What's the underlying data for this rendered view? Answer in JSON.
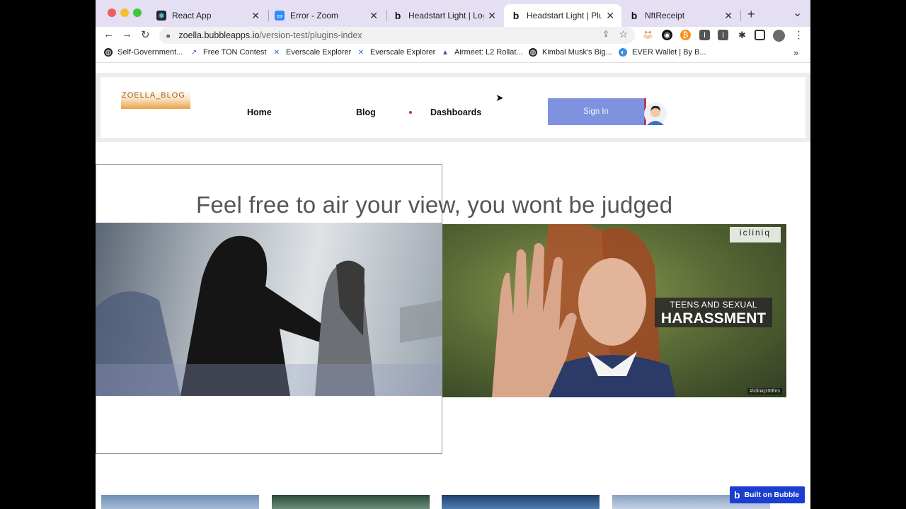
{
  "tabs": [
    {
      "label": "React App",
      "icon": "react-icon",
      "close": "✕"
    },
    {
      "label": "Error - Zoom",
      "icon": "zoom-icon",
      "close": "✕"
    },
    {
      "label": "Headstart Light | Login",
      "icon": "bubble-icon",
      "close": "✕"
    },
    {
      "label": "Headstart Light | Plugins",
      "icon": "bubble-icon",
      "close": "✕",
      "active": true
    },
    {
      "label": "NftReceipt",
      "icon": "bubble-icon",
      "close": "✕"
    }
  ],
  "new_tab": "+",
  "tab_menu": "⌄",
  "toolbar": {
    "back": "←",
    "forward": "→",
    "reload": "↻",
    "url_host": "zoella.bubbleapps.io",
    "url_path": "/version-test/plugins-index"
  },
  "bookmarks": [
    {
      "label": "Self-Government...",
      "icon": "globe-icon"
    },
    {
      "label": "Free TON Contest",
      "icon": "ton-icon"
    },
    {
      "label": "Everscale Explorer",
      "icon": "everscale-icon"
    },
    {
      "label": "Everscale Explorer",
      "icon": "everscale-icon"
    },
    {
      "label": "Airmeet: L2 Rollat...",
      "icon": "airmeet-icon"
    },
    {
      "label": "Kimbal Musk's Big...",
      "icon": "globe-icon"
    },
    {
      "label": "EVER Wallet | By B...",
      "icon": "ever-wallet-icon"
    }
  ],
  "bookmarks_more": "»",
  "site": {
    "logo": "ZOELLA_BLOG",
    "nav": {
      "home": "Home",
      "blog": "Blog",
      "dashboards": "Dashboards"
    },
    "sign_in": "Sign In",
    "heading": "Feel free to air your view, you wont be judged",
    "image2_caption_line1": "TEENS AND SEXUAL",
    "image2_caption_line2": "HARASSMENT",
    "image2_brand": "icliniq",
    "image2_tag": "#icliniq100hrs"
  },
  "bubble_badge": "Built on Bubble",
  "colors": {
    "tabstrip": "#e4dff3",
    "sign_in_bg": "#7e92e0",
    "bubble_badge": "#1b3dd0",
    "heading": "#555555"
  }
}
